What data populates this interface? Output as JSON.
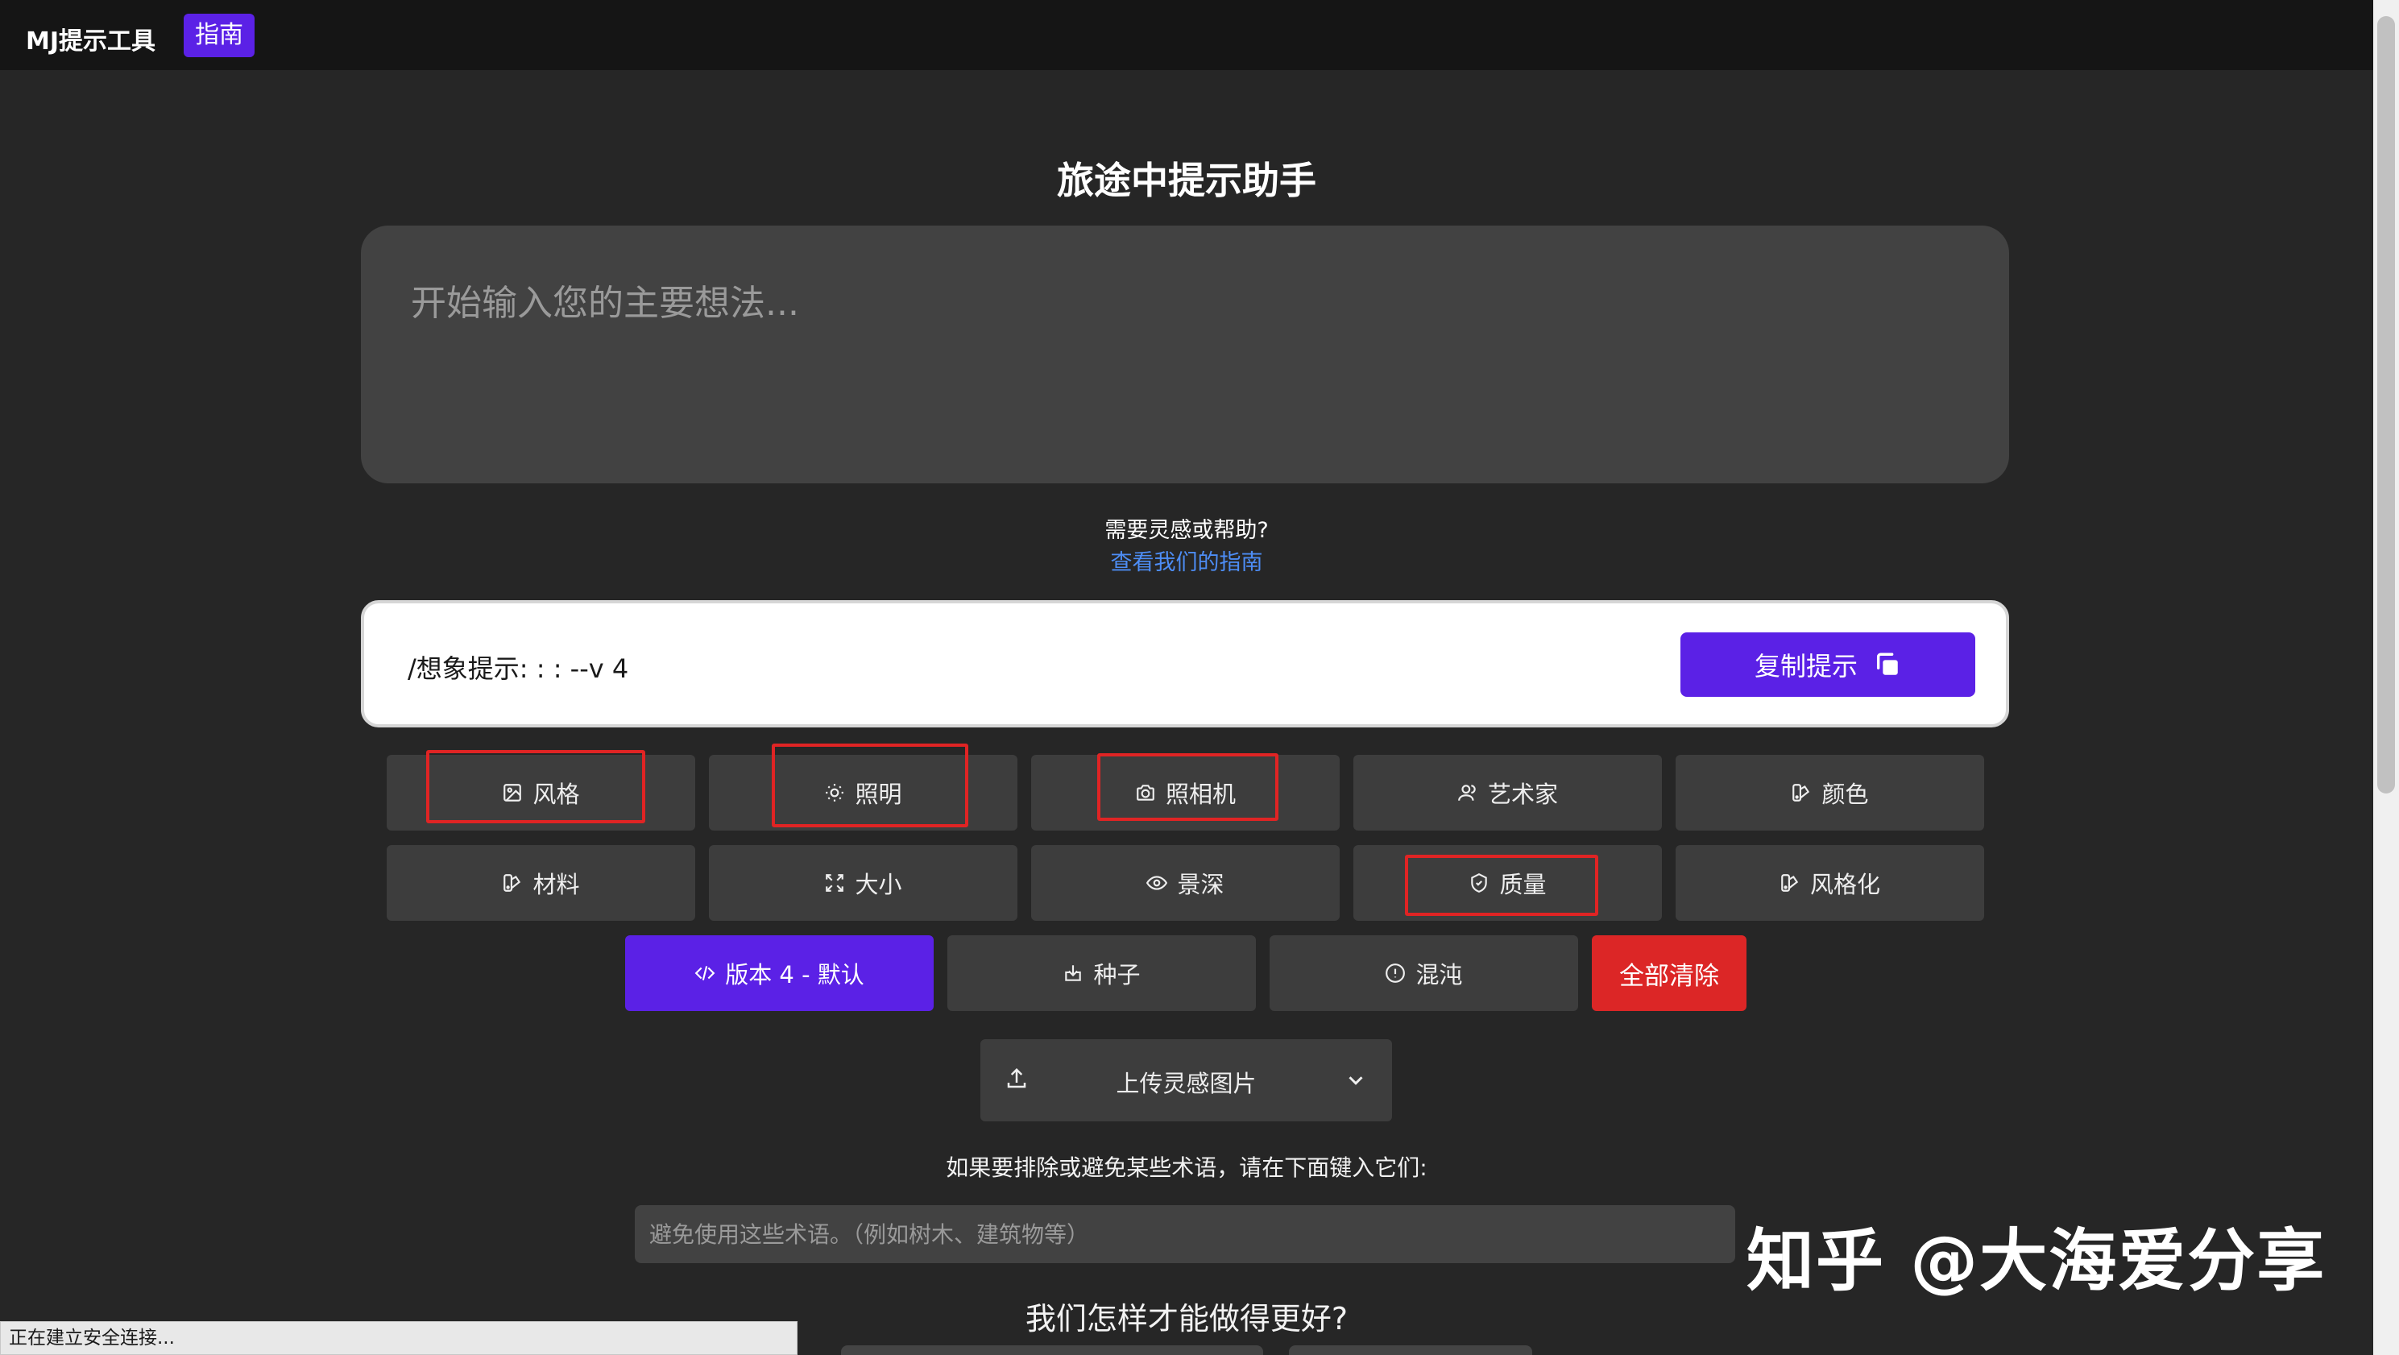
{
  "header": {
    "brand": "MJ提示工具",
    "nav_guide": "指南"
  },
  "main": {
    "title": "旅途中提示助手",
    "idea_placeholder": "开始输入您的主要想法...",
    "help_question": "需要灵感或帮助?",
    "help_link": "查看我们的指南"
  },
  "prompt": {
    "text": "/想象提示: : :  --v 4",
    "copy_label": "复制提示"
  },
  "options": {
    "row1": [
      {
        "label": "风格",
        "icon": "image-icon"
      },
      {
        "label": "照明",
        "icon": "lightbulb-icon"
      },
      {
        "label": "照相机",
        "icon": "camera-icon"
      },
      {
        "label": "艺术家",
        "icon": "users-icon"
      },
      {
        "label": "颜色",
        "icon": "palette-icon"
      }
    ],
    "row2": [
      {
        "label": "材料",
        "icon": "palette-icon"
      },
      {
        "label": "大小",
        "icon": "expand-icon"
      },
      {
        "label": "景深",
        "icon": "eye-icon"
      },
      {
        "label": "质量",
        "icon": "shield-icon"
      },
      {
        "label": "风格化",
        "icon": "palette-icon"
      }
    ],
    "row3": [
      {
        "label": "版本 4 - 默认",
        "icon": "code-icon"
      },
      {
        "label": "种子",
        "icon": "download-icon"
      },
      {
        "label": "混沌",
        "icon": "alert-circle-icon"
      },
      {
        "label": "全部清除"
      }
    ]
  },
  "upload": {
    "label": "上传灵感图片"
  },
  "exclude": {
    "label": "如果要排除或避免某些术语，请在下面键入它们:",
    "placeholder": "避免使用这些术语。（例如树木、建筑物等）"
  },
  "feedback": {
    "question": "我们怎样才能做得更好?"
  },
  "status_bar": {
    "text": "正在建立安全连接..."
  },
  "watermark": {
    "text": "知乎 @大海爱分享"
  },
  "colors": {
    "accent": "#5b21e6",
    "danger": "#dc2626",
    "background": "#262626",
    "highlight": "#e02424"
  }
}
